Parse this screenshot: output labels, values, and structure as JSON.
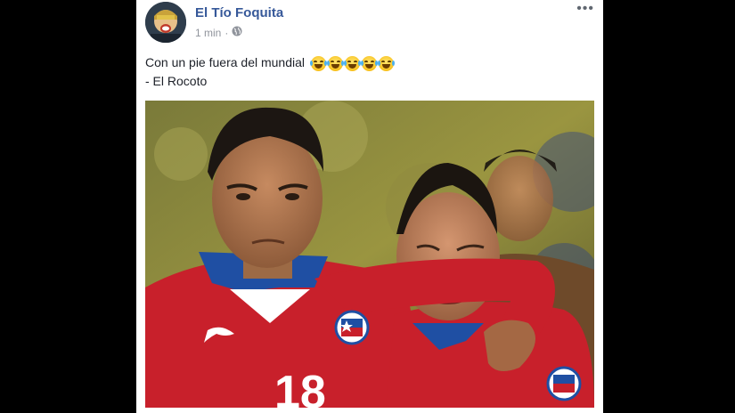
{
  "post": {
    "author": "El Tío Foquita",
    "time": "1 min",
    "separator": "·",
    "privacy_icon": "globe-icon",
    "more_label": "•••",
    "text_line1": "Con un pie fuera del mundial",
    "text_line2": "- El Rocoto",
    "emoji_count": 5,
    "emoji_icon": "laughing-tears-emoji"
  },
  "photo": {
    "jersey_number": "18"
  },
  "colors": {
    "author_link": "#365899",
    "meta_text": "#90949c",
    "body_text": "#1d2129",
    "jersey_red": "#c8202b",
    "jersey_blue": "#1f4fa3"
  }
}
